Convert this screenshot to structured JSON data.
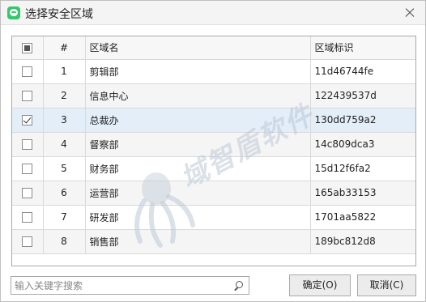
{
  "window": {
    "title": "选择安全区域"
  },
  "table": {
    "columns": [
      "#",
      "区域名",
      "区域标识"
    ],
    "rows": [
      {
        "num": "1",
        "name": "剪辑部",
        "id": "11d46744fe",
        "checked": false
      },
      {
        "num": "2",
        "name": "信息中心",
        "id": "122439537d",
        "checked": false
      },
      {
        "num": "3",
        "name": "总裁办",
        "id": "130dd759a2",
        "checked": true
      },
      {
        "num": "4",
        "name": "督察部",
        "id": "14c809dca3",
        "checked": false
      },
      {
        "num": "5",
        "name": "财务部",
        "id": "15d12f6fa2",
        "checked": false
      },
      {
        "num": "6",
        "name": "运营部",
        "id": "165ab33153",
        "checked": false
      },
      {
        "num": "7",
        "name": "研发部",
        "id": "1701aa5822",
        "checked": false
      },
      {
        "num": "8",
        "name": "销售部",
        "id": "189bc812d8",
        "checked": false
      }
    ]
  },
  "watermark": {
    "text": "域智盾软件"
  },
  "search": {
    "placeholder": "输入关键字搜索",
    "value": ""
  },
  "buttons": {
    "ok": "确定(O)",
    "cancel": "取消(C)"
  },
  "colors": {
    "selected_row": "#e3eef8",
    "app_icon": "#37c86b"
  }
}
